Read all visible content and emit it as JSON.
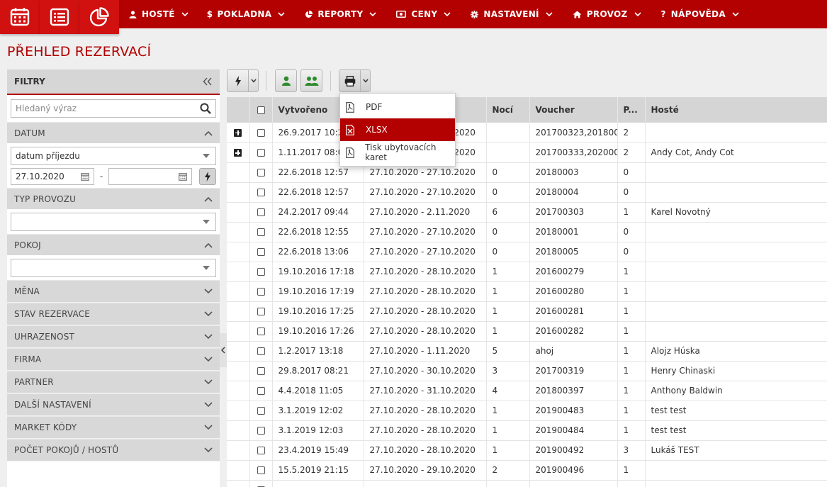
{
  "nav": {
    "items": [
      {
        "label": "HOSTÉ",
        "icon": "user-icon"
      },
      {
        "label": "POKLADNA",
        "icon": "dollar-icon"
      },
      {
        "label": "REPORTY",
        "icon": "pie-chart-icon"
      },
      {
        "label": "CENY",
        "icon": "money-icon"
      },
      {
        "label": "NASTAVENÍ",
        "icon": "gear-icon"
      },
      {
        "label": "PROVOZ",
        "icon": "home-icon"
      },
      {
        "label": "NÁPOVĚDA",
        "icon": "question-icon"
      }
    ]
  },
  "page": {
    "title": "PŘEHLED REZERVACÍ"
  },
  "sidebar": {
    "header": "FILTRY",
    "search_placeholder": "Hledaný výraz",
    "datum": {
      "label": "DATUM",
      "mode": "datum příjezdu",
      "from": "27.10.2020",
      "to": "",
      "separator": "-"
    },
    "typ_provozu": {
      "label": "TYP PROVOZU",
      "value": ""
    },
    "pokoj": {
      "label": "POKOJ",
      "value": ""
    },
    "sections": [
      "MĚNA",
      "STAV REZERVACE",
      "UHRAZENOST",
      "FIRMA",
      "PARTNER",
      "DALŠÍ NASTAVENÍ",
      "MARKET KÓDY",
      "POČET POKOJŮ / HOSTŮ"
    ]
  },
  "export_menu": {
    "items": [
      {
        "label": "PDF",
        "icon": "pdf-file-icon",
        "active": false
      },
      {
        "label": "XLSX",
        "icon": "excel-file-icon",
        "active": true
      },
      {
        "label": "Tisk ubytovacích karet",
        "icon": "pdf-file-icon",
        "active": false
      }
    ]
  },
  "table": {
    "columns": [
      "Vytvořeno",
      "",
      "Nocí",
      "Voucher",
      "P...",
      "Hosté"
    ],
    "rows": [
      {
        "expand": true,
        "created": "26.9.2017 10:23",
        "dates": "27.10.2020 - 28.10.2020",
        "nights": "",
        "voucher": "201700323,201800...",
        "p": "2",
        "guests": ""
      },
      {
        "expand": true,
        "created": "1.11.2017 08:06",
        "dates": "27.10.2020 - 28.10.2020",
        "nights": "",
        "voucher": "201700333,202000...",
        "p": "2",
        "guests": "Andy Cot, Andy Cot"
      },
      {
        "expand": false,
        "created": "22.6.2018 12:57",
        "dates": "27.10.2020 - 27.10.2020",
        "nights": "0",
        "voucher": "20180003",
        "p": "0",
        "guests": ""
      },
      {
        "expand": false,
        "created": "22.6.2018 12:57",
        "dates": "27.10.2020 - 27.10.2020",
        "nights": "0",
        "voucher": "20180004",
        "p": "0",
        "guests": ""
      },
      {
        "expand": false,
        "created": "24.2.2017 09:44",
        "dates": "27.10.2020 - 2.11.2020",
        "nights": "6",
        "voucher": "201700303",
        "p": "1",
        "guests": "Karel Novotný"
      },
      {
        "expand": false,
        "created": "22.6.2018 12:55",
        "dates": "27.10.2020 - 27.10.2020",
        "nights": "0",
        "voucher": "20180001",
        "p": "0",
        "guests": ""
      },
      {
        "expand": false,
        "created": "22.6.2018 13:06",
        "dates": "27.10.2020 - 27.10.2020",
        "nights": "0",
        "voucher": "20180005",
        "p": "0",
        "guests": ""
      },
      {
        "expand": false,
        "created": "19.10.2016 17:18",
        "dates": "27.10.2020 - 28.10.2020",
        "nights": "1",
        "voucher": "201600279",
        "p": "1",
        "guests": ""
      },
      {
        "expand": false,
        "created": "19.10.2016 17:19",
        "dates": "27.10.2020 - 28.10.2020",
        "nights": "1",
        "voucher": "201600280",
        "p": "1",
        "guests": ""
      },
      {
        "expand": false,
        "created": "19.10.2016 17:25",
        "dates": "27.10.2020 - 28.10.2020",
        "nights": "1",
        "voucher": "201600281",
        "p": "1",
        "guests": ""
      },
      {
        "expand": false,
        "created": "19.10.2016 17:26",
        "dates": "27.10.2020 - 28.10.2020",
        "nights": "1",
        "voucher": "201600282",
        "p": "1",
        "guests": ""
      },
      {
        "expand": false,
        "created": "1.2.2017 13:18",
        "dates": "27.10.2020 - 1.11.2020",
        "nights": "5",
        "voucher": "ahoj",
        "p": "1",
        "guests": "Alojz Húska"
      },
      {
        "expand": false,
        "created": "29.8.2017 08:21",
        "dates": "27.10.2020 - 30.10.2020",
        "nights": "3",
        "voucher": "201700319",
        "p": "1",
        "guests": "Henry Chinaski"
      },
      {
        "expand": false,
        "created": "4.4.2018 11:05",
        "dates": "27.10.2020 - 31.10.2020",
        "nights": "4",
        "voucher": "201800397",
        "p": "1",
        "guests": "Anthony Baldwin"
      },
      {
        "expand": false,
        "created": "3.1.2019 12:02",
        "dates": "27.10.2020 - 28.10.2020",
        "nights": "1",
        "voucher": "201900483",
        "p": "1",
        "guests": "test test"
      },
      {
        "expand": false,
        "created": "3.1.2019 12:03",
        "dates": "27.10.2020 - 28.10.2020",
        "nights": "1",
        "voucher": "201900484",
        "p": "1",
        "guests": "test test"
      },
      {
        "expand": false,
        "created": "23.4.2019 15:49",
        "dates": "27.10.2020 - 28.10.2020",
        "nights": "1",
        "voucher": "201900492",
        "p": "3",
        "guests": "Lukáš TEST"
      },
      {
        "expand": false,
        "created": "15.5.2019 21:15",
        "dates": "27.10.2020 - 29.10.2020",
        "nights": "2",
        "voucher": "201900496",
        "p": "1",
        "guests": ""
      },
      {
        "expand": false,
        "created": "",
        "dates": "",
        "nights": "",
        "voucher": "",
        "p": "",
        "guests": ""
      }
    ]
  },
  "colors": {
    "brand": "#b30000",
    "brand_light": "#d11010",
    "guest_icon": "#2e8b2e"
  }
}
